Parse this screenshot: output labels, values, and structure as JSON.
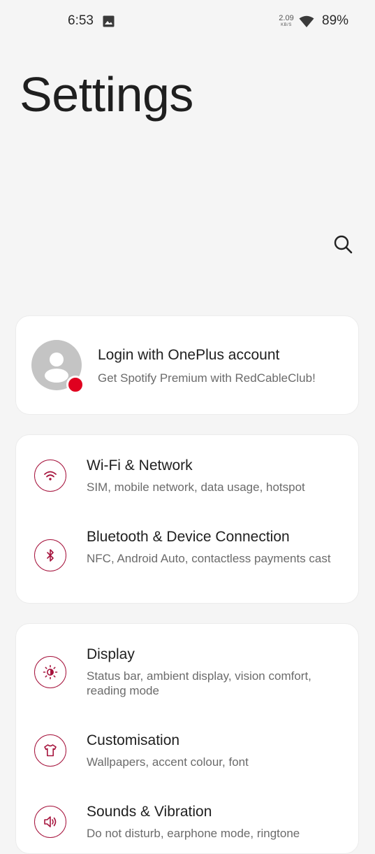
{
  "status_bar": {
    "time": "6:53",
    "speed_value": "2.09",
    "speed_unit": "KB/S",
    "battery": "89%",
    "icons": [
      "image-icon",
      "wifi-icon"
    ]
  },
  "header": {
    "title": "Settings",
    "search_icon": "search-icon"
  },
  "account": {
    "title": "Login with OnePlus account",
    "subtitle": "Get Spotify Premium with RedCableClub!",
    "badge_color": "#e0001f"
  },
  "network_group": [
    {
      "title": "Wi-Fi & Network",
      "subtitle": "SIM, mobile network, data usage, hotspot",
      "icon": "wifi-icon"
    },
    {
      "title": "Bluetooth & Device Connection",
      "subtitle": "NFC, Android Auto, contactless payments cast",
      "icon": "bluetooth-icon"
    }
  ],
  "device_group": [
    {
      "title": "Display",
      "subtitle": "Status bar, ambient display, vision comfort, reading mode",
      "icon": "brightness-icon"
    },
    {
      "title": "Customisation",
      "subtitle": "Wallpapers, accent colour, font",
      "icon": "tshirt-icon"
    },
    {
      "title": "Sounds & Vibration",
      "subtitle": "Do not disturb, earphone mode, ringtone",
      "icon": "speaker-icon"
    }
  ],
  "colors": {
    "accent": "#a6143d",
    "background": "#f5f5f5",
    "card": "#ffffff"
  }
}
